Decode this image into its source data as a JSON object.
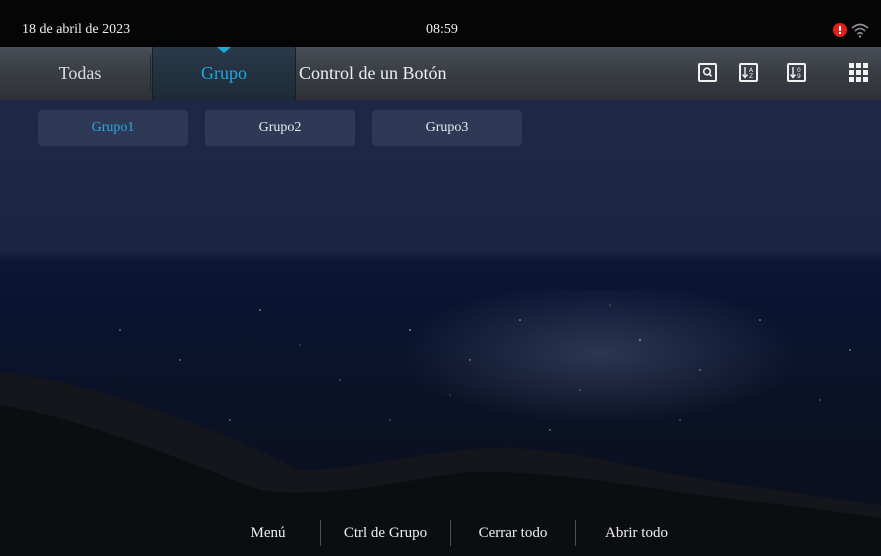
{
  "status_bar": {
    "date": "18 de abril de 2023",
    "time": "08:59",
    "alert_icon": "alert-icon",
    "wifi_icon": "wifi-icon"
  },
  "tabs": [
    {
      "label": "Todas",
      "active": false
    },
    {
      "label": "Grupo",
      "active": true
    },
    {
      "label": "Control de un Botón",
      "active": false
    }
  ],
  "toolbar": {
    "icons": [
      "search-icon",
      "sort-alpha-icon",
      "sort-numeric-icon",
      "grid-menu-icon"
    ]
  },
  "groups": [
    {
      "label": "Grupo1",
      "selected": true
    },
    {
      "label": "Grupo2",
      "selected": false
    },
    {
      "label": "Grupo3",
      "selected": false
    }
  ],
  "bottom_bar": {
    "menu": "Menú",
    "group_control": "Ctrl de Grupo",
    "close_all": "Cerrar todo",
    "open_all": "Abrir todo"
  },
  "colors": {
    "accent": "#20a8e0",
    "alert": "#e0201a",
    "status_bar_bg": "#050505",
    "tab_bar_bg": "#383c43",
    "chip_bg": "#2e3a55"
  }
}
